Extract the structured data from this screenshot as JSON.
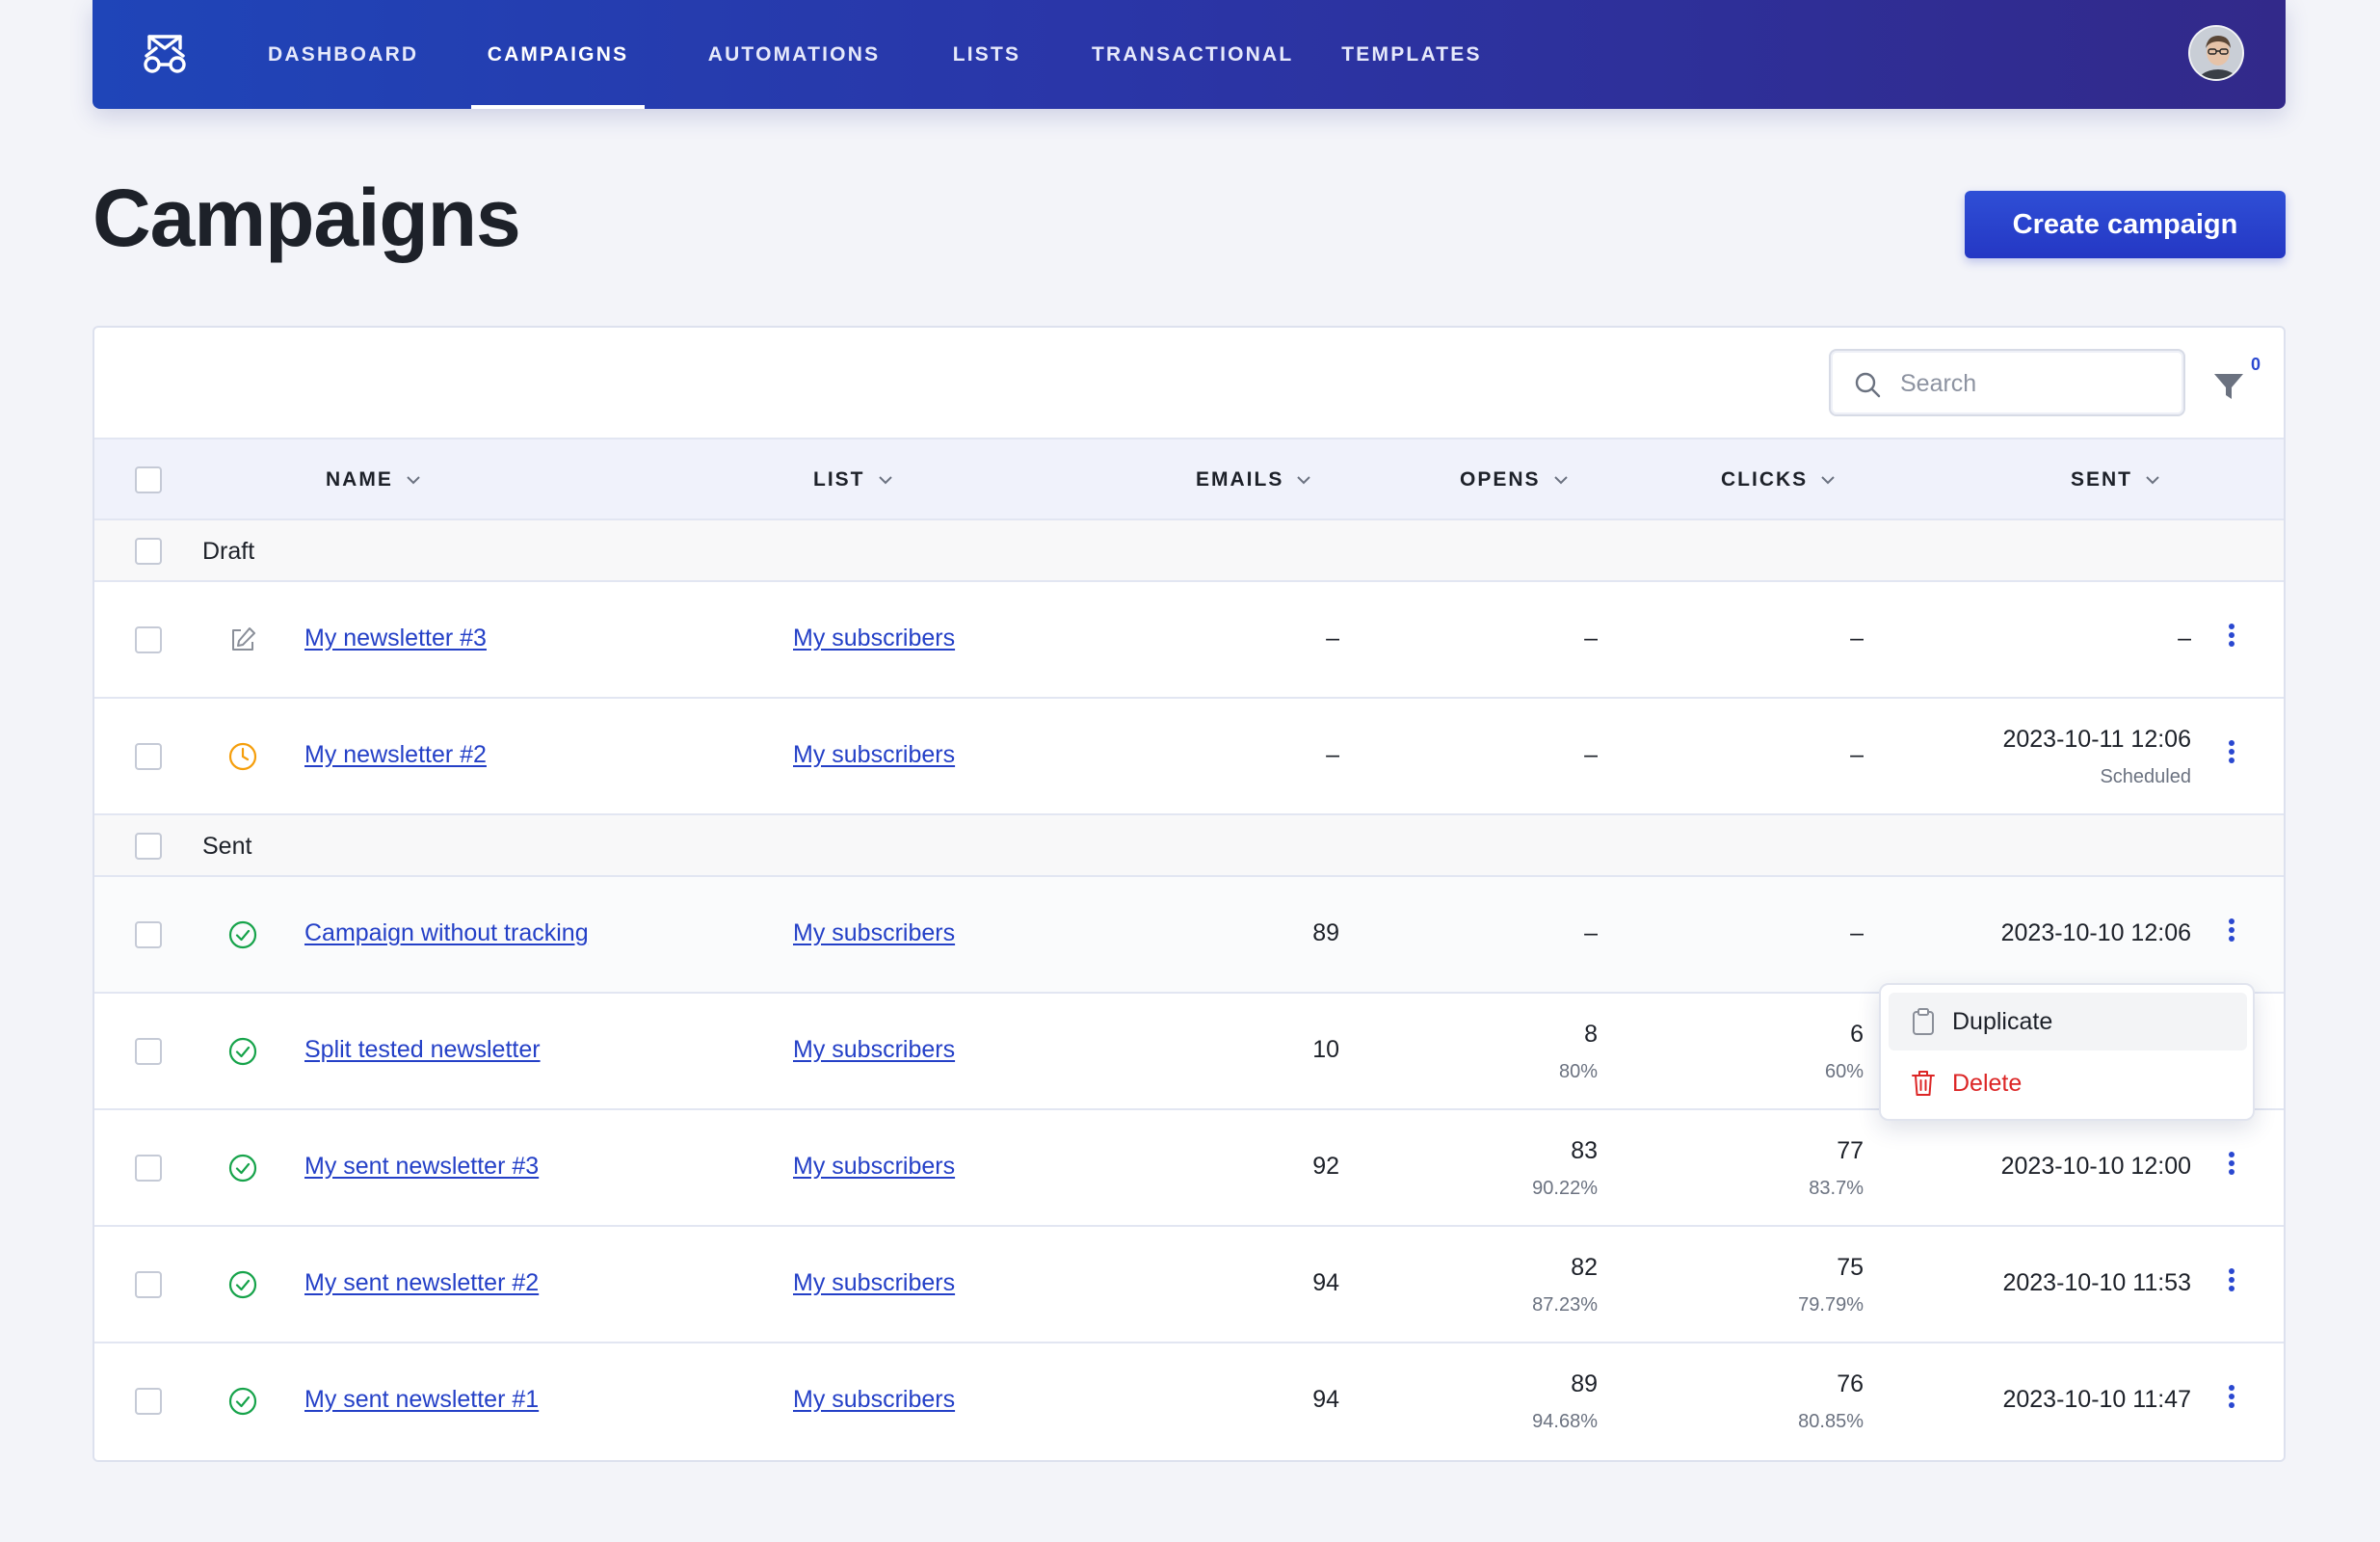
{
  "nav": {
    "items": [
      {
        "label": "DASHBOARD",
        "active": false
      },
      {
        "label": "CAMPAIGNS",
        "active": true
      },
      {
        "label": "AUTOMATIONS",
        "active": false
      },
      {
        "label": "LISTS",
        "active": false
      },
      {
        "label": "TRANSACTIONAL",
        "active": false
      },
      {
        "label": "TEMPLATES",
        "active": false
      }
    ],
    "logo_icon": "mailcoach-logo-icon",
    "avatar_icon": "user-avatar"
  },
  "page": {
    "title": "Campaigns",
    "create_button": "Create campaign"
  },
  "toolbar": {
    "search_placeholder": "Search",
    "filter_count": "0"
  },
  "table": {
    "columns": {
      "name": "NAME",
      "list": "LIST",
      "emails": "EMAILS",
      "opens": "OPENS",
      "clicks": "CLICKS",
      "sent": "SENT"
    },
    "groups": {
      "draft": "Draft",
      "sent": "Sent"
    },
    "rows": [
      {
        "status_icon": "pencil-icon",
        "name": "My newsletter #3",
        "list": "My subscribers",
        "emails": "–",
        "opens": "–",
        "opens_pct": "",
        "clicks": "–",
        "clicks_pct": "",
        "sent": "–",
        "sent_sub": ""
      },
      {
        "status_icon": "clock-icon",
        "name": "My newsletter #2",
        "list": "My subscribers",
        "emails": "–",
        "opens": "–",
        "opens_pct": "",
        "clicks": "–",
        "clicks_pct": "",
        "sent": "2023-10-11 12:06",
        "sent_sub": "Scheduled"
      },
      {
        "status_icon": "check-circle-icon",
        "name": "Campaign without tracking",
        "list": "My subscribers",
        "emails": "89",
        "opens": "–",
        "opens_pct": "",
        "clicks": "–",
        "clicks_pct": "",
        "sent": "2023-10-10 12:06",
        "sent_sub": ""
      },
      {
        "status_icon": "check-circle-icon",
        "name": "Split tested newsletter",
        "list": "My subscribers",
        "emails": "10",
        "opens": "8",
        "opens_pct": "80%",
        "clicks": "6",
        "clicks_pct": "60%",
        "sent": "",
        "sent_sub": ""
      },
      {
        "status_icon": "check-circle-icon",
        "name": "My sent newsletter #3",
        "list": "My subscribers",
        "emails": "92",
        "opens": "83",
        "opens_pct": "90.22%",
        "clicks": "77",
        "clicks_pct": "83.7%",
        "sent": "2023-10-10 12:00",
        "sent_sub": ""
      },
      {
        "status_icon": "check-circle-icon",
        "name": "My sent newsletter #2",
        "list": "My subscribers",
        "emails": "94",
        "opens": "82",
        "opens_pct": "87.23%",
        "clicks": "75",
        "clicks_pct": "79.79%",
        "sent": "2023-10-10 11:53",
        "sent_sub": ""
      },
      {
        "status_icon": "check-circle-icon",
        "name": "My sent newsletter #1",
        "list": "My subscribers",
        "emails": "94",
        "opens": "89",
        "opens_pct": "94.68%",
        "clicks": "76",
        "clicks_pct": "80.85%",
        "sent": "2023-10-10 11:47",
        "sent_sub": ""
      }
    ]
  },
  "dropdown": {
    "duplicate": "Duplicate",
    "delete": "Delete"
  },
  "colors": {
    "accent": "#2440c7",
    "danger": "#dc2626",
    "success": "#16a34a",
    "warning": "#f59e0b"
  }
}
